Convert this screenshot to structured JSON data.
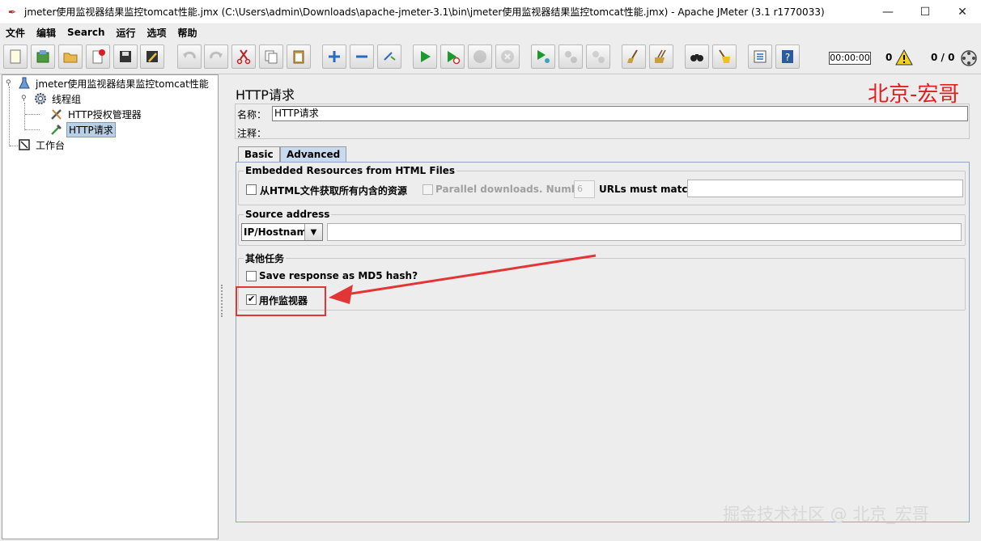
{
  "window": {
    "title": "jmeter使用监视器结果监控tomcat性能.jmx (C:\\Users\\admin\\Downloads\\apache-jmeter-3.1\\bin\\jmeter使用监视器结果监控tomcat性能.jmx) - Apache JMeter (3.1 r1770033)",
    "minimize": "—",
    "maximize": "☐",
    "close": "✕"
  },
  "menu": [
    "文件",
    "编辑",
    "Search",
    "运行",
    "选项",
    "帮助"
  ],
  "status": {
    "timer": "00:00:00",
    "error_count": "0",
    "threads": "0 / 0"
  },
  "tree": {
    "root": "jmeter使用监视器结果监控tomcat性能",
    "thread_group": "线程组",
    "auth_manager": "HTTP授权管理器",
    "http_request": "HTTP请求",
    "workbench": "工作台"
  },
  "panel": {
    "title": "HTTP请求",
    "watermark_top": "北京-宏哥",
    "name_label": "名称：",
    "name_value": "HTTP请求",
    "comment_label": "注释："
  },
  "tabs": [
    {
      "label": "Basic",
      "active": false
    },
    {
      "label": "Advanced",
      "active": true
    }
  ],
  "embedded": {
    "legend": "Embedded Resources from HTML Files",
    "retrieve_all_label": "从HTML文件获取所有内含的资源",
    "retrieve_all_checked": false,
    "parallel_label": "Parallel downloads. Number:",
    "parallel_number": "6",
    "urls_must_match_label": "URLs must match:",
    "urls_must_match_value": ""
  },
  "source": {
    "legend": "Source address",
    "type_selected": "IP/Hostname",
    "address_value": ""
  },
  "other": {
    "legend": "其他任务",
    "md5_label": "Save response as MD5 hash?",
    "md5_checked": false,
    "monitor_label": "用作监视器",
    "monitor_checked": true
  },
  "watermark_bottom": "掘金技术社区 @ 北京_宏哥",
  "colors": {
    "annotation_red": "#e23636",
    "selected_bg": "#b8cfe5",
    "tab_active": "#c8daf0"
  }
}
